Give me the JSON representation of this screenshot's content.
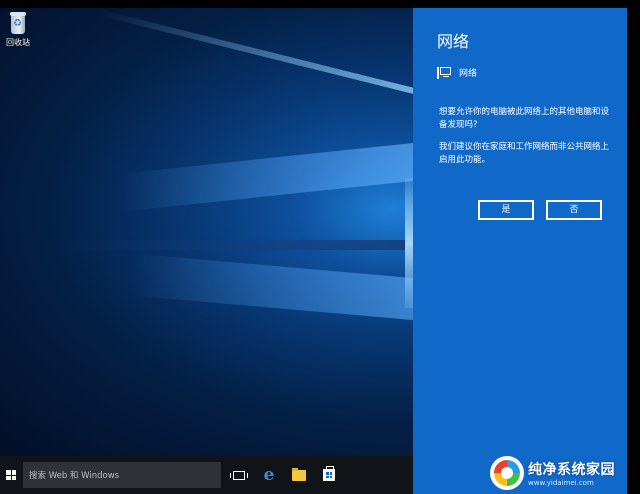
{
  "desktop": {
    "recycle_bin_label": "回收站"
  },
  "panel": {
    "title": "网络",
    "subhead_label": "网络",
    "subhead_icon": "network-monitor-icon",
    "paragraph1": "想要允许你的电脑被此网络上的其他电脑和设备发现吗?",
    "paragraph2": "我们建议你在家庭和工作网络而非公共网络上启用此功能。",
    "yes_label": "是",
    "no_label": "否",
    "accent_color": "#1068c9"
  },
  "taskbar": {
    "search_placeholder": "搜索 Web 和 Windows",
    "icons": [
      "windows-logo-icon",
      "task-view-icon",
      "edge-icon",
      "file-explorer-icon",
      "store-icon"
    ]
  },
  "watermark": {
    "title": "纯净系统家园",
    "url": "www.yidaimei.com"
  }
}
